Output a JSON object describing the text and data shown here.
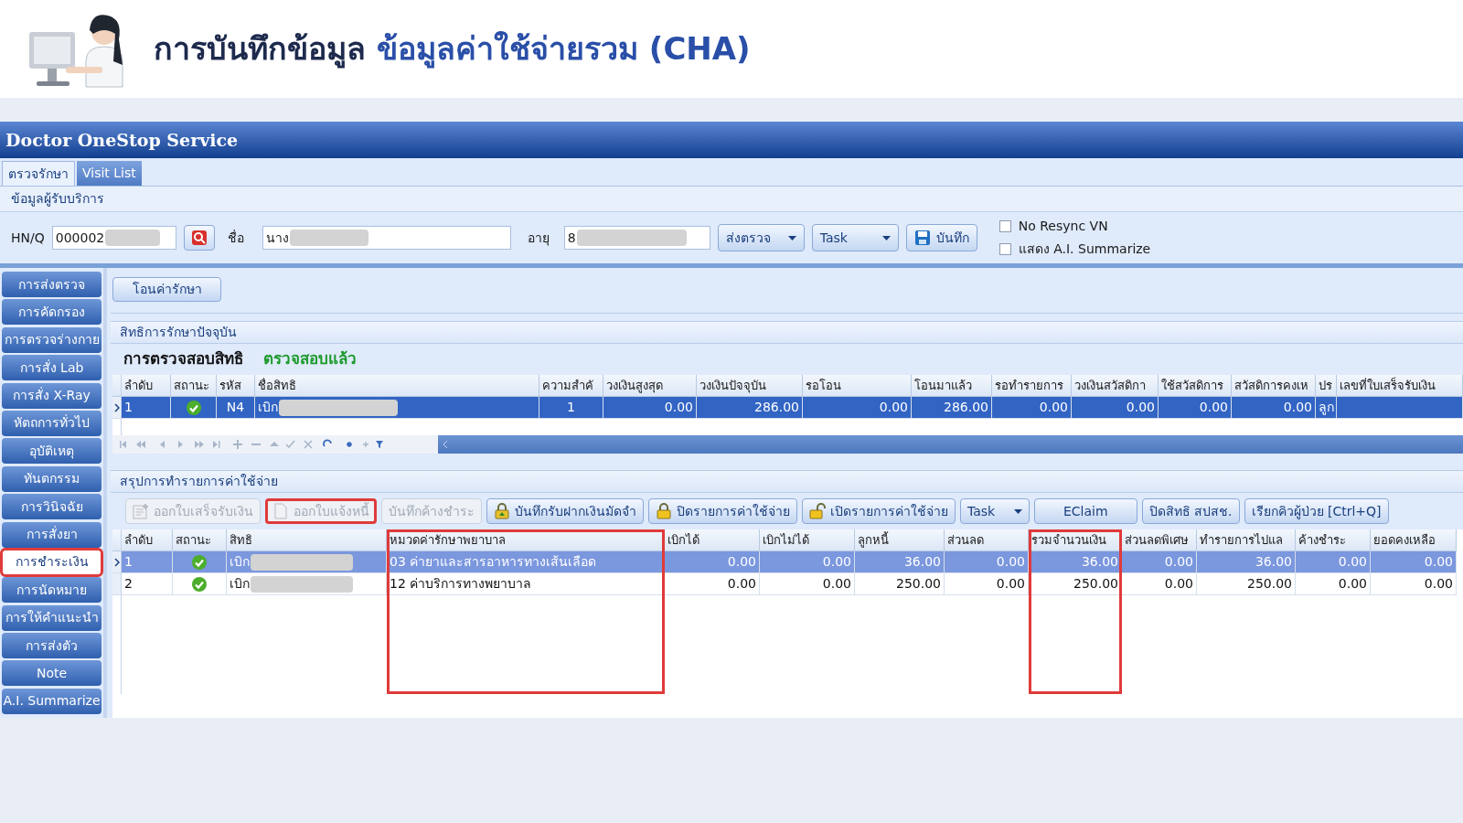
{
  "slide": {
    "title": "การบันทึกข้อมูล",
    "subtitle": "ข้อมูลค่าใช้จ่ายรวม (CHA)"
  },
  "window": {
    "title": "Doctor OneStop Service"
  },
  "tabs": [
    {
      "label": "ตรวจรักษา",
      "selected": true
    },
    {
      "label": "Visit List",
      "selected": false
    }
  ],
  "patient": {
    "section": "ข้อมูลผู้รับบริการ",
    "hn_label": "HN/Q",
    "hn": "000002",
    "name_label": "ชื่อ",
    "name": "นาง",
    "age_label": "อายุ",
    "age": "8",
    "buttons": [
      {
        "label": "ส่งตรวจ",
        "kind": "dropdown"
      },
      {
        "label": "Task",
        "kind": "dropdown"
      },
      {
        "label": "บันทึก",
        "kind": "save"
      }
    ],
    "checkboxes": [
      {
        "label": "No Resync VN",
        "checked": false
      },
      {
        "label": "แสดง A.I. Summarize",
        "checked": false
      }
    ]
  },
  "sidebar": {
    "items": [
      {
        "label": "การส่งตรวจ",
        "selected": false,
        "highlighted": false
      },
      {
        "label": "การคัดกรอง",
        "selected": false,
        "highlighted": false
      },
      {
        "label": "การตรวจร่างกาย",
        "selected": false,
        "highlighted": false
      },
      {
        "label": "การสั่ง Lab",
        "selected": false,
        "highlighted": false
      },
      {
        "label": "การสั่ง X-Ray",
        "selected": false,
        "highlighted": false
      },
      {
        "label": "หัตถการทั่วไป",
        "selected": false,
        "highlighted": false
      },
      {
        "label": "อุบัติเหตุ",
        "selected": false,
        "highlighted": false
      },
      {
        "label": "ทันตกรรม",
        "selected": false,
        "highlighted": false
      },
      {
        "label": "การวินิจฉัย",
        "selected": false,
        "highlighted": false
      },
      {
        "label": "การสั่งยา",
        "selected": false,
        "highlighted": false
      },
      {
        "label": "การชำระเงิน",
        "selected": true,
        "highlighted": true
      },
      {
        "label": "การนัดหมาย",
        "selected": false,
        "highlighted": false
      },
      {
        "label": "การให้คำแนะนำ",
        "selected": false,
        "highlighted": false
      },
      {
        "label": "การส่งตัว",
        "selected": false,
        "highlighted": false
      },
      {
        "label": "Note",
        "selected": false,
        "highlighted": false
      },
      {
        "label": "A.I. Summarize",
        "selected": false,
        "highlighted": false
      }
    ]
  },
  "transfer_button": "โอนค่ารักษา",
  "rights": {
    "section": "สิทธิการรักษาปัจจุบัน",
    "check_label": "การตรวจสอบสิทธิ",
    "check_status": "ตรวจสอบแล้ว",
    "columns": [
      {
        "label": "ลำดับ"
      },
      {
        "label": "สถานะ"
      },
      {
        "label": "รหัส"
      },
      {
        "label": "ชื่อสิทธิ"
      },
      {
        "label": "ความสำคั"
      },
      {
        "label": "วงเงินสูงสุด"
      },
      {
        "label": "วงเงินปัจจุบัน"
      },
      {
        "label": "รอโอน"
      },
      {
        "label": "โอนมาแล้ว"
      },
      {
        "label": "รอทำรายการ"
      },
      {
        "label": "วงเงินสวัสดิกา"
      },
      {
        "label": "ใช้สวัสดิการ"
      },
      {
        "label": "สวัสดิการคงเห"
      },
      {
        "label": "ปร"
      },
      {
        "label": "เลขที่ใบเสร็จรับเงิน"
      }
    ],
    "rows": [
      {
        "selected": true,
        "approved": true,
        "cells": [
          "1",
          "",
          "N4",
          "เบิก",
          "1",
          "0.00",
          "286.00",
          "0.00",
          "286.00",
          "0.00",
          "0.00",
          "0.00",
          "0.00",
          "ลูก",
          ""
        ]
      }
    ]
  },
  "expenses": {
    "section": "สรุปการทำรายการค่าใช้จ่าย",
    "buttons": [
      {
        "label": "ออกใบเสร็จรับเงิน",
        "kind": "receipt",
        "disabled": true,
        "highlighted": false
      },
      {
        "label": "ออกใบแจ้งหนี้",
        "kind": "page",
        "disabled": true,
        "highlighted": true
      },
      {
        "label": "บันทึกค้างชำระ",
        "kind": "plain",
        "disabled": true,
        "highlighted": false
      },
      {
        "label": "บันทึกรับฝากเงินมัดจำ",
        "kind": "deposit",
        "disabled": false,
        "highlighted": false
      },
      {
        "label": "ปิดรายการค่าใช้จ่าย",
        "kind": "lock",
        "disabled": false,
        "highlighted": false
      },
      {
        "label": "เปิดรายการค่าใช้จ่าย",
        "kind": "unlock",
        "disabled": false,
        "highlighted": false
      },
      {
        "label": "Task",
        "kind": "dropdown",
        "disabled": false,
        "highlighted": false
      },
      {
        "label": "EClaim",
        "kind": "plain",
        "disabled": false,
        "highlighted": false
      },
      {
        "label": "ปิดสิทธิ สปสช.",
        "kind": "plain",
        "disabled": false,
        "highlighted": false
      },
      {
        "label": "เรียกคิวผู้ป่วย [Ctrl+Q]",
        "kind": "plain",
        "disabled": false,
        "highlighted": false
      }
    ],
    "columns": [
      {
        "label": "ลำดับ",
        "highlighted": false
      },
      {
        "label": "สถานะ",
        "highlighted": false
      },
      {
        "label": "สิทธิ",
        "highlighted": false
      },
      {
        "label": "หมวดค่ารักษาพยาบาล",
        "highlighted": true
      },
      {
        "label": "เบิกได้",
        "highlighted": false
      },
      {
        "label": "เบิกไม่ได้",
        "highlighted": false
      },
      {
        "label": "ลูกหนี้",
        "highlighted": false
      },
      {
        "label": "ส่วนลด",
        "highlighted": false
      },
      {
        "label": "รวมจำนวนเงิน",
        "highlighted": true
      },
      {
        "label": "ส่วนลดพิเศษ",
        "highlighted": false
      },
      {
        "label": "ทำรายการไปแล",
        "highlighted": false
      },
      {
        "label": "ค้างชำระ",
        "highlighted": false
      },
      {
        "label": "ยอดคงเหลือ",
        "highlighted": false
      }
    ],
    "rows": [
      {
        "selected": true,
        "approved": true,
        "cells": [
          "1",
          "",
          "เบิก",
          "03 ค่ายาและสารอาหารทางเส้นเลือด",
          "0.00",
          "0.00",
          "36.00",
          "0.00",
          "36.00",
          "0.00",
          "36.00",
          "0.00",
          "0.00"
        ]
      },
      {
        "selected": false,
        "approved": true,
        "cells": [
          "2",
          "",
          "เบิก",
          "12 ค่าบริการทางพยาบาล",
          "0.00",
          "0.00",
          "250.00",
          "0.00",
          "250.00",
          "0.00",
          "250.00",
          "0.00",
          "0.00"
        ]
      }
    ]
  }
}
